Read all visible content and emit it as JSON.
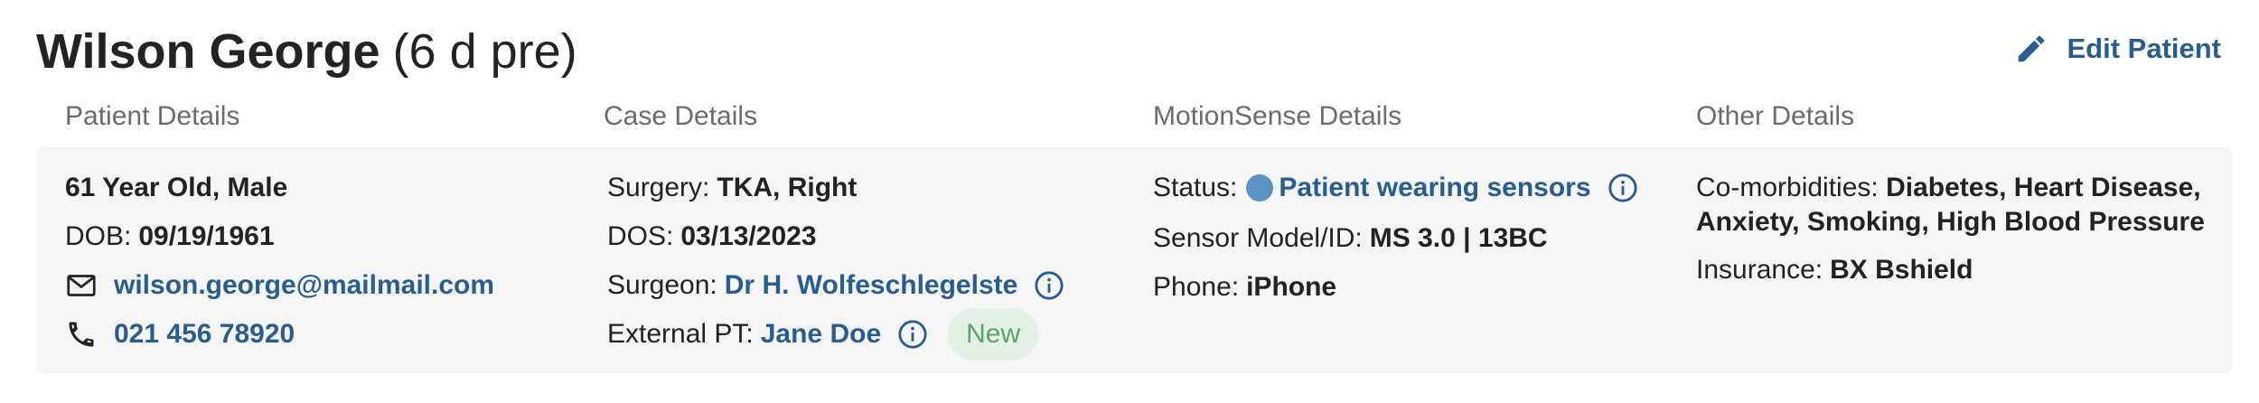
{
  "header": {
    "name": "Wilson George",
    "subtitle": "(6 d pre)",
    "edit_label": "Edit Patient"
  },
  "sections": {
    "patient": "Patient Details",
    "case": "Case Details",
    "motionsense": "MotionSense Details",
    "other": "Other Details"
  },
  "patient": {
    "age_sex": "61 Year Old, Male",
    "dob_label": "DOB:",
    "dob": "09/19/1961",
    "email": "wilson.george@mailmail.com",
    "phone": "021 456 78920"
  },
  "case": {
    "surgery_label": "Surgery:",
    "surgery": "TKA, Right",
    "dos_label": "DOS:",
    "dos": "03/13/2023",
    "surgeon_label": "Surgeon:",
    "surgeon": "Dr H. Wolfeschlegelste",
    "external_pt_label": "External PT:",
    "external_pt": "Jane Doe",
    "badge": "New"
  },
  "motionsense": {
    "status_label": "Status:",
    "status": "Patient wearing sensors",
    "status_color": "#5a93c6",
    "sensor_label": "Sensor Model/ID:",
    "sensor": "MS 3.0 | 13BC",
    "phone_label": "Phone:",
    "phone": "iPhone"
  },
  "other": {
    "comorbidities_label": "Co-morbidities:",
    "comorbidities": "Diabetes, Heart Disease, Anxiety, Smoking, High Blood Pressure",
    "insurance_label": "Insurance:",
    "insurance": "BX Bshield"
  },
  "icons": {
    "edit": "pencil-icon",
    "email": "mail-icon",
    "phone": "phone-icon",
    "info": "info-icon"
  },
  "colors": {
    "link": "#2a5d8f",
    "badge_bg": "#e2f1e3",
    "badge_text": "#5aa26a",
    "card_bg": "#f5f5f5"
  }
}
